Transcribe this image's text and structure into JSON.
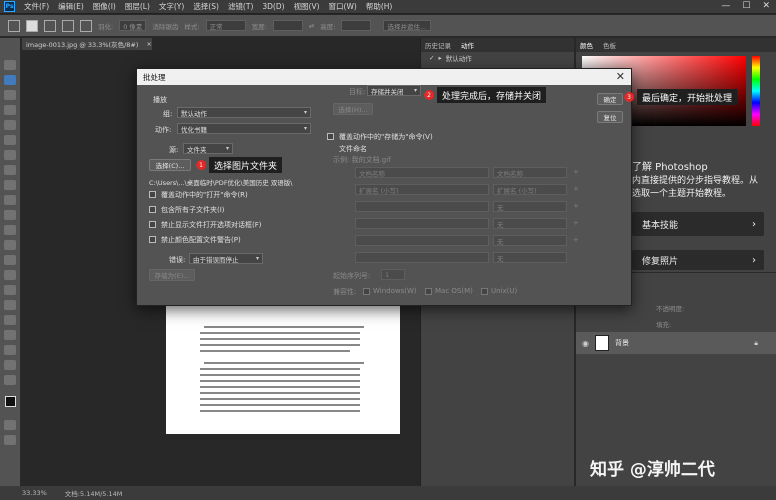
{
  "menubar": {
    "items": [
      "文件(F)",
      "编辑(E)",
      "图像(I)",
      "图层(L)",
      "文字(Y)",
      "选择(S)",
      "滤镜(T)",
      "3D(D)",
      "视图(V)",
      "窗口(W)",
      "帮助(H)"
    ],
    "win_controls": [
      "—",
      "☐",
      "✕"
    ]
  },
  "optionsbar": {
    "feather_label": "羽化:",
    "feather_value": "0 像素",
    "antialias_label": "消除锯齿",
    "style_label": "样式:",
    "style_value": "正常",
    "width_label": "宽度:",
    "height_label": "高度:",
    "select_mask_label": "选择并遮住..."
  },
  "document": {
    "tab_title": "image-0013.jpg @ 33.3%(灰色/8#)",
    "tab_close": "×"
  },
  "history_panel": {
    "tabs": [
      "历史记录",
      "动作"
    ],
    "row_label": "默认动作"
  },
  "color_panel": {
    "tabs": [
      "颜色",
      "色板"
    ]
  },
  "learn_panel": {
    "title": "了解 Photoshop",
    "desc_line1": "内直接提供的分步指导教程。从",
    "desc_line2": "选取一个主题开始教程。",
    "cards": [
      {
        "label": "基本技能",
        "chevron": "›"
      },
      {
        "label": "修复照片",
        "chevron": "›"
      }
    ]
  },
  "layers_panel": {
    "opacity_label": "不透明度:",
    "fill_label": "填充:",
    "layer_name": "背景"
  },
  "statusbar": {
    "zoom": "33.33%",
    "doc_info": "文档:5.14M/5.14M"
  },
  "dialog": {
    "title": "批处理",
    "close": "✕",
    "play_section": "播放",
    "set_label": "组:",
    "set_value": "默认动作",
    "action_label": "动作:",
    "action_value": "优化书籍",
    "source_label": "源:",
    "source_value": "文件夹",
    "choose_button": "选择(C)...",
    "source_path": "C:\\Users\\...\\桌面临时\\PDF优化\\美国历史 双语版\\",
    "checks_left": [
      "覆盖动作中的\"打开\"命令(R)",
      "包含所有子文件夹(I)",
      "禁止显示文件打开选项对话框(F)",
      "禁止颜色配置文件警告(P)"
    ],
    "errors_label": "错误:",
    "errors_value": "由于错误而停止",
    "save_as_button": "存储为(E)...",
    "dest_label": "目标:",
    "dest_value": "存储并关闭",
    "dest_choose_button": "选择(H)...",
    "override_save_check": "覆盖动作中的\"存储为\"命令(V)",
    "file_naming_section": "文件命名",
    "example_text": "示例: 我的文档.gif",
    "naming_fields": [
      [
        "文档名称",
        "文档名称"
      ],
      [
        "扩展名 (小写)",
        "扩展名 (小写)"
      ],
      [
        "",
        "无"
      ],
      [
        "",
        "无"
      ],
      [
        "",
        "无"
      ],
      [
        "",
        "无"
      ]
    ],
    "plus": "+",
    "serial_label": "起始序列号:",
    "serial_value": "1",
    "compat_label": "兼容性:",
    "compat_options": [
      "Windows(W)",
      "Mac OS(M)",
      "Unix(U)"
    ],
    "ok_button": "确定",
    "reset_button": "复位"
  },
  "callouts": [
    {
      "num": "1",
      "text": "选择图片文件夹"
    },
    {
      "num": "2",
      "text": "处理完成后，存储并关闭"
    },
    {
      "num": "3",
      "text": "最后确定，开始批处理"
    }
  ],
  "watermark": "知乎 @淳帅二代"
}
